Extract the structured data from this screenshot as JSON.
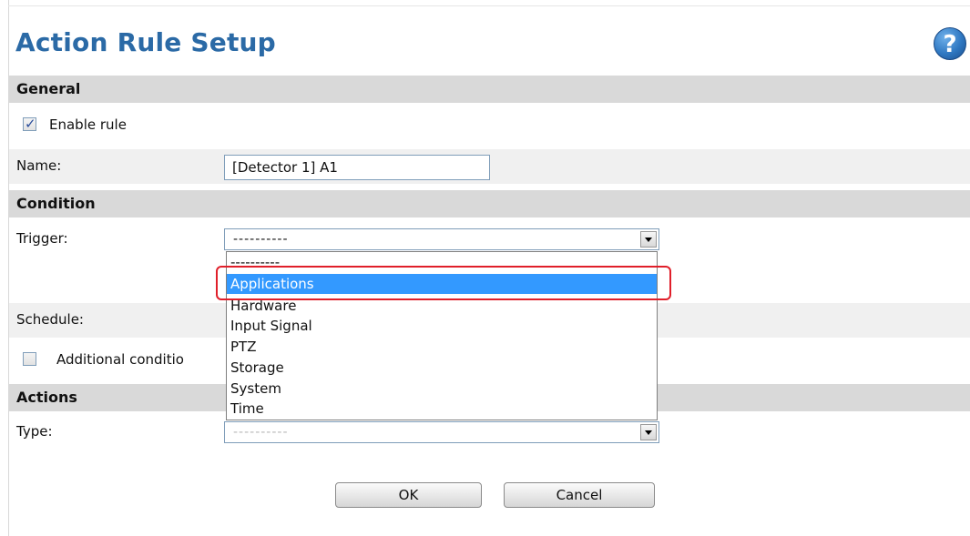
{
  "page": {
    "title": "Action Rule Setup",
    "help_icon_glyph": "?"
  },
  "general": {
    "section_label": "General",
    "enable_rule": {
      "label": "Enable rule",
      "checked": true
    },
    "name": {
      "label": "Name:",
      "value": "[Detector 1] A1"
    }
  },
  "condition": {
    "section_label": "Condition",
    "trigger": {
      "label": "Trigger:",
      "selected_value": "----------",
      "options": [
        "----------",
        "Applications",
        "Hardware",
        "Input Signal",
        "PTZ",
        "Storage",
        "System",
        "Time"
      ],
      "highlighted_option": "Applications"
    },
    "schedule": {
      "label": "Schedule:"
    },
    "additional_conditions": {
      "label": "Additional conditio",
      "checked": false
    }
  },
  "actions": {
    "section_label": "Actions",
    "type": {
      "label": "Type:",
      "selected_value": "----------"
    }
  },
  "buttons": {
    "ok_label": "OK",
    "cancel_label": "Cancel"
  },
  "colors": {
    "title": "#2b6aa6",
    "section_bar": "#d9d9d9",
    "selection": "#3399ff",
    "annotation_highlight": "#e01f2a"
  }
}
